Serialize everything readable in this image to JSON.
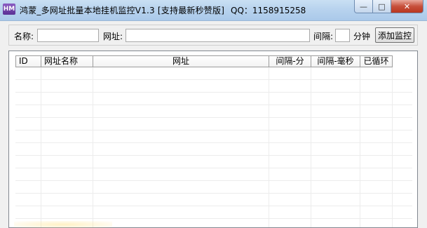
{
  "window": {
    "app_icon_text": "HM",
    "title": "鸿蒙_多网址批量本地挂机监控V1.3 [支持最新秒赞版]",
    "qq": "QQ：1158915258",
    "min_glyph": "—",
    "max_glyph": "□",
    "close_glyph": "✕"
  },
  "form": {
    "name_label": "名称:",
    "name_value": "",
    "url_label": "网址:",
    "url_value": "",
    "interval_label": "间隔:",
    "interval_value": "",
    "interval_unit": "分钟",
    "add_button": "添加监控"
  },
  "table": {
    "columns": [
      "ID",
      "网址名称",
      "网址",
      "间隔-分",
      "间隔-毫秒",
      "已循环"
    ],
    "rows": []
  }
}
